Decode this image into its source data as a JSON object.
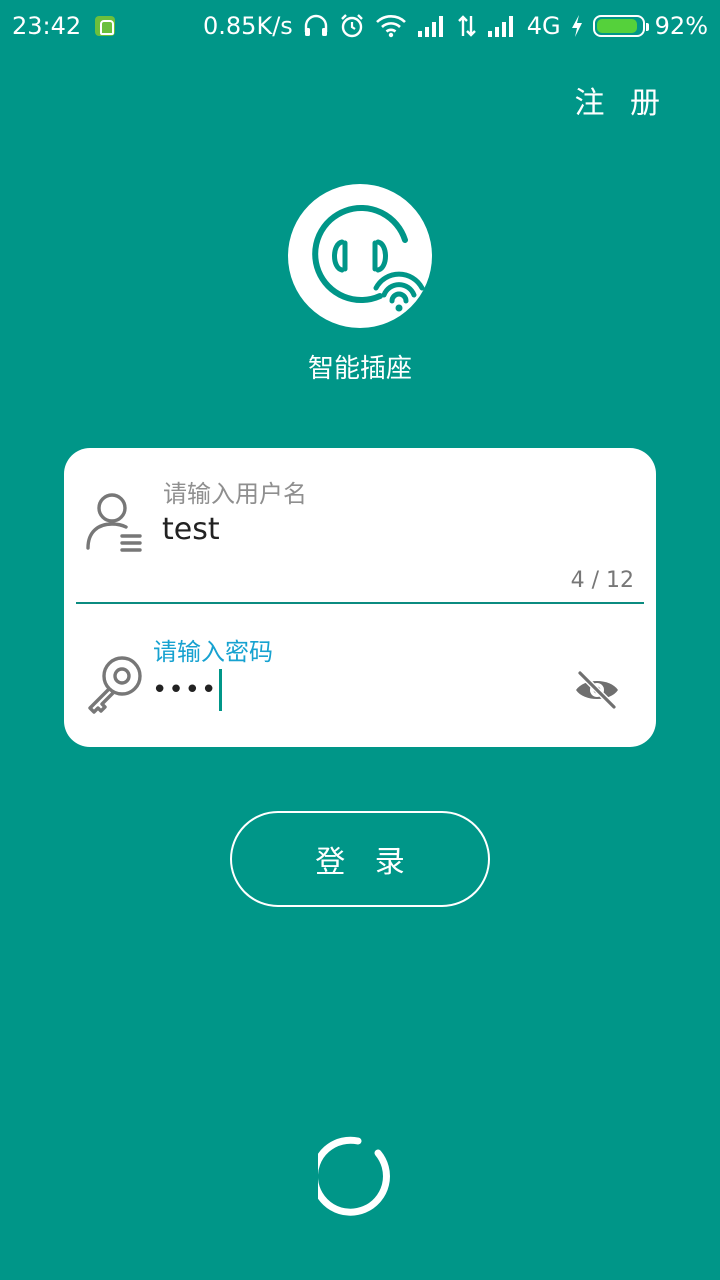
{
  "status_bar": {
    "time": "23:42",
    "net_speed": "0.85K/s",
    "network_type": "4G",
    "battery_percent": "92%",
    "battery_level": 0.92,
    "icons": [
      "app-notification-icon",
      "headphones-icon",
      "alarm-icon",
      "wifi-icon",
      "signal-icon",
      "data-transfer-icon",
      "signal-icon",
      "charging-icon",
      "battery-icon"
    ]
  },
  "header": {
    "register_label": "注 册"
  },
  "logo": {
    "icon": "smart-socket-logo-icon",
    "app_name": "智能插座"
  },
  "form": {
    "username": {
      "hint": "请输入用户名",
      "value": "test",
      "counter": "4 / 12",
      "icon": "user-icon"
    },
    "password": {
      "hint": "请输入密码",
      "value": "••••",
      "icon": "key-icon",
      "toggle_icon": "eye-off-icon"
    }
  },
  "login_button": {
    "label": "登 录"
  },
  "loading": {
    "icon": "loading-spinner-icon"
  },
  "colors": {
    "background": "#009688",
    "card": "#ffffff",
    "accent_hint": "#17a2d0",
    "divider": "#0b8b80",
    "battery_fill": "#55d13b"
  }
}
